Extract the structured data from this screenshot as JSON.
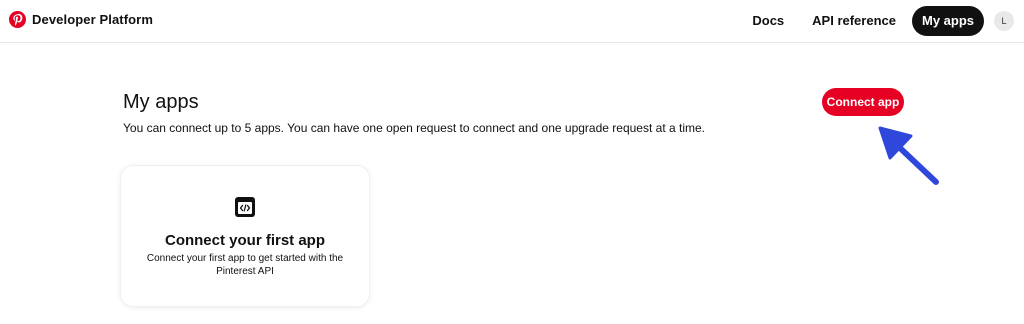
{
  "brand": {
    "name": "Developer Platform",
    "logo_icon": "pinterest-logo-icon",
    "color": "#e60023"
  },
  "nav": {
    "items": [
      {
        "label": "Docs",
        "active": false
      },
      {
        "label": "API reference",
        "active": false
      },
      {
        "label": "My apps",
        "active": true
      }
    ],
    "avatar_initial": "L"
  },
  "main": {
    "title": "My apps",
    "description": "You can connect up to 5 apps. You can have one open request to connect and one upgrade request at a time.",
    "connect_button_label": "Connect app",
    "arrow_color": "#2f48db",
    "card": {
      "icon": "code-icon",
      "title": "Connect your first app",
      "description": "Connect your first app to get started with the Pinterest API"
    }
  }
}
